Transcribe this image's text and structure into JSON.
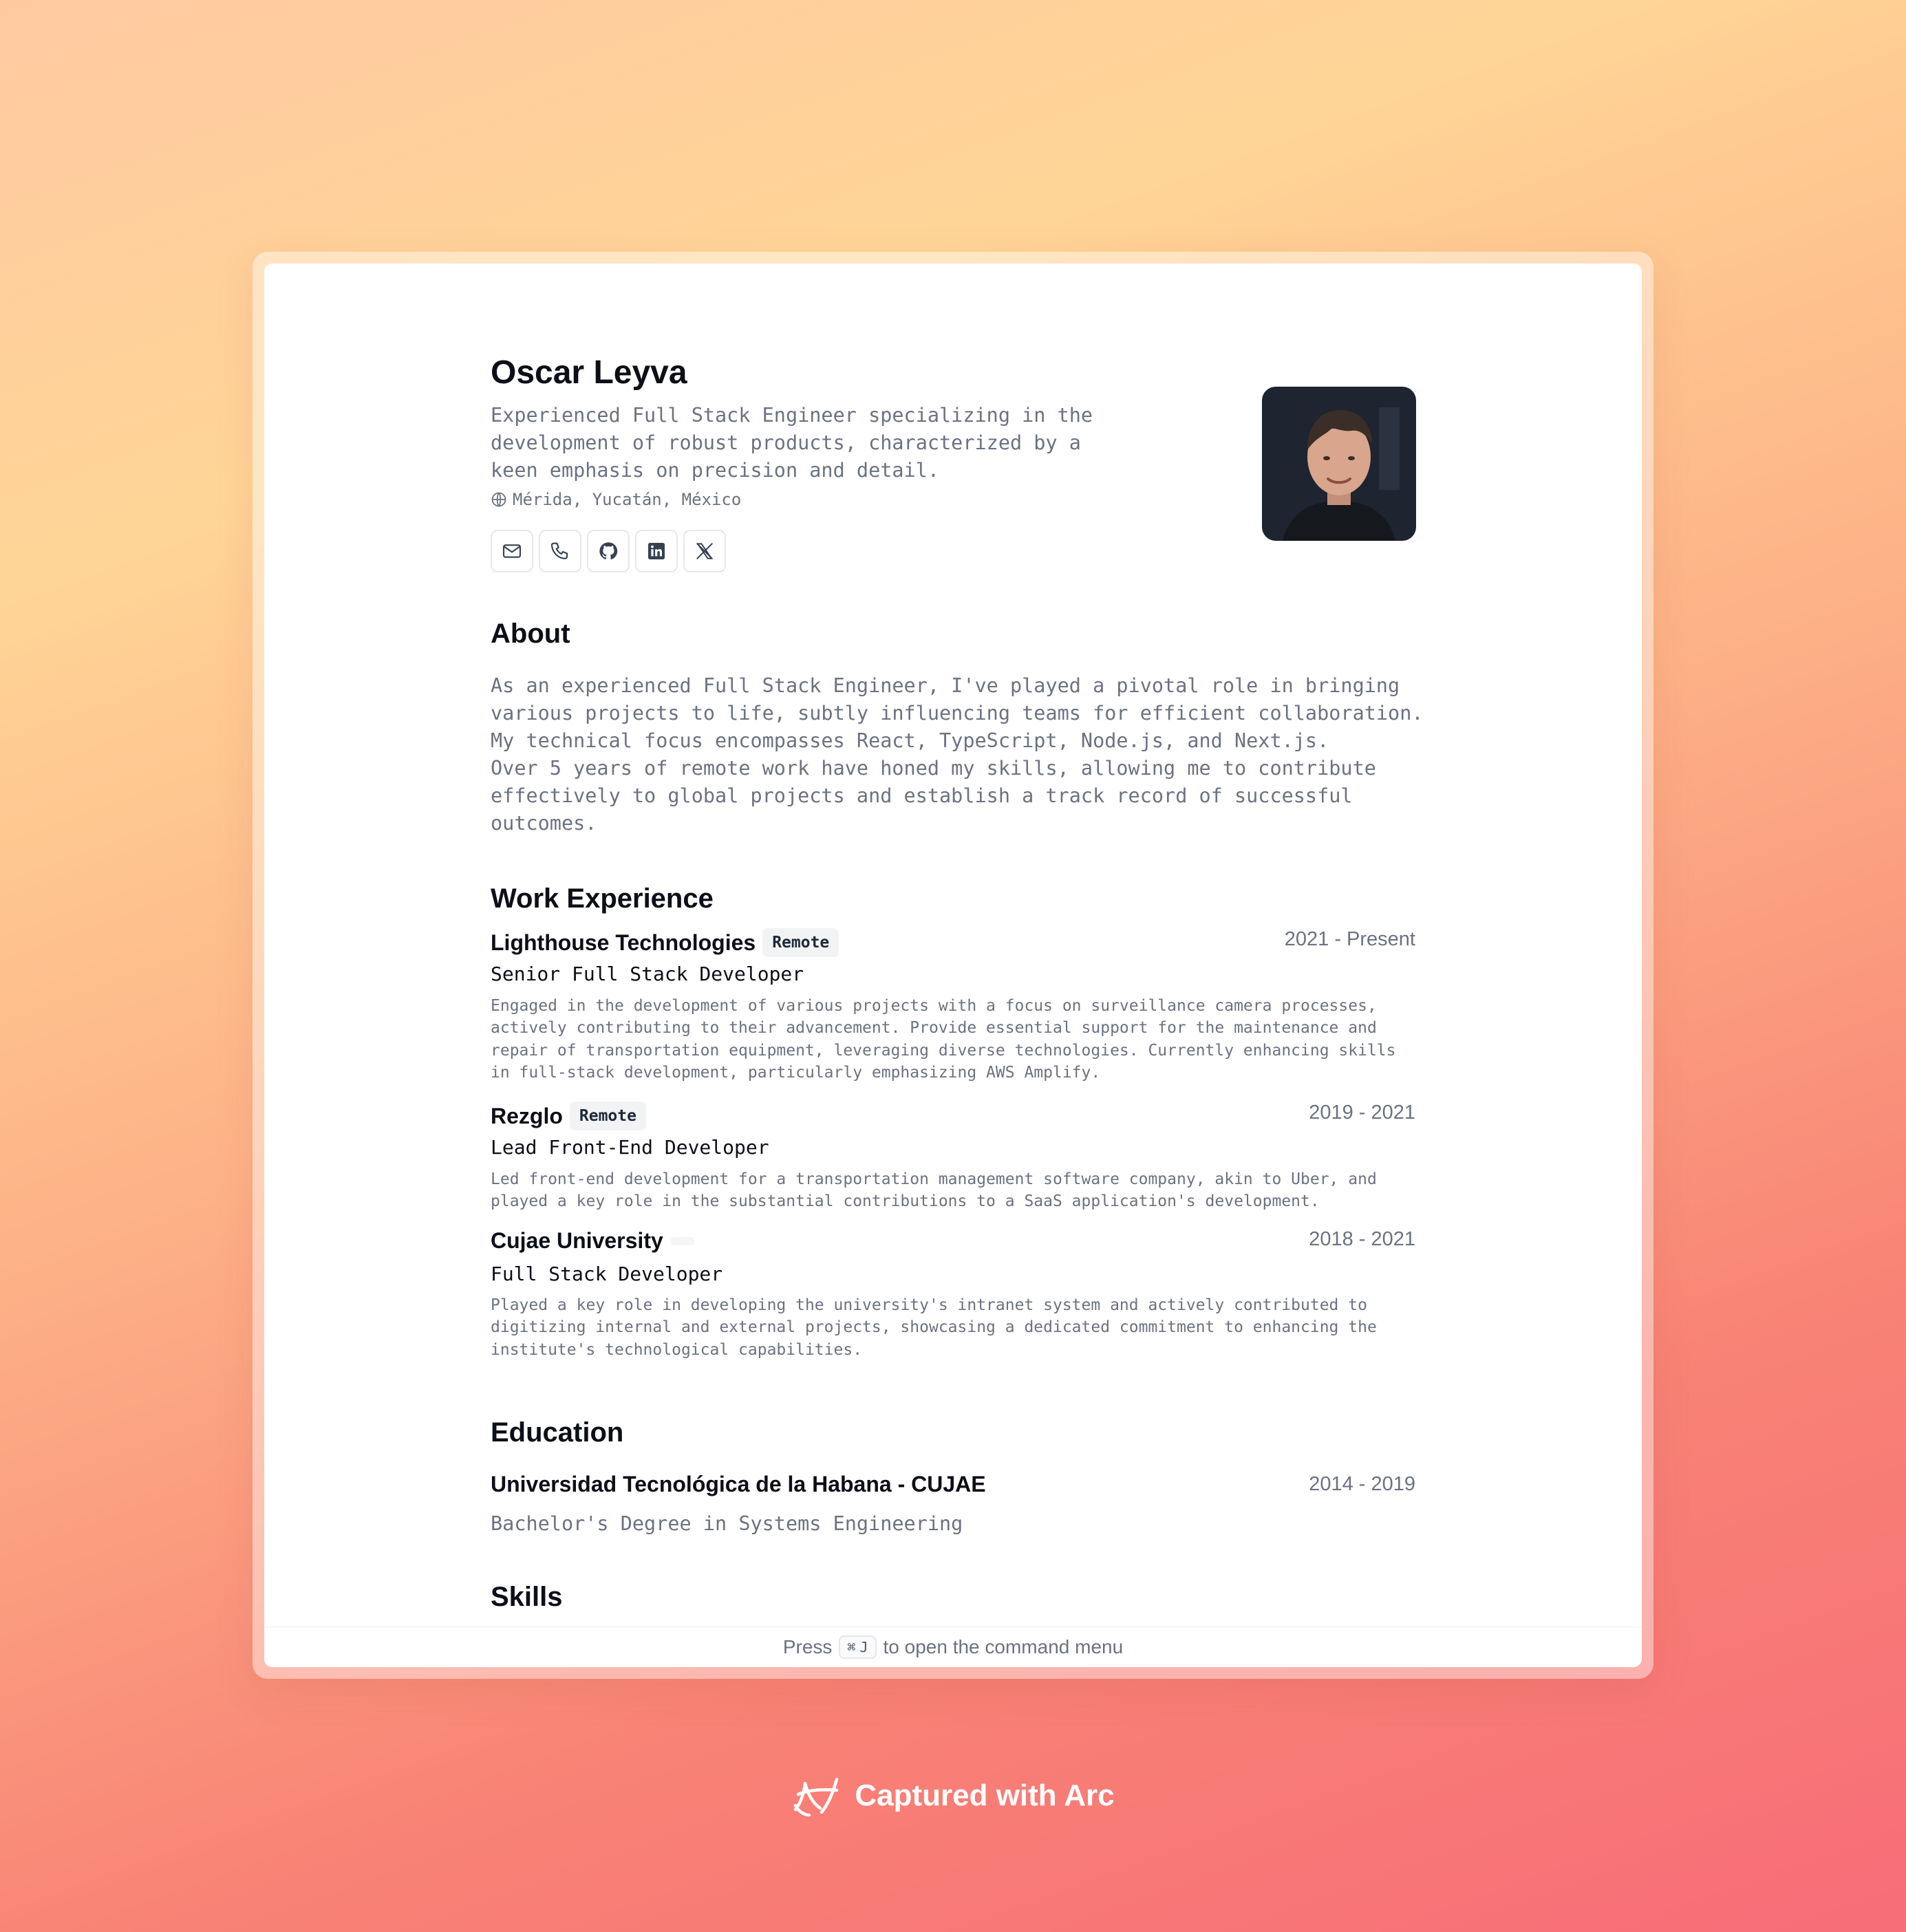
{
  "resume": {
    "name": "Oscar Leyva",
    "summary": "Experienced Full Stack Engineer specializing in the development of robust products, characterized by a keen emphasis on precision and detail.",
    "location": "Mérida, Yucatán, México",
    "contact_icons": [
      "mail-icon",
      "phone-icon",
      "github-icon",
      "linkedin-icon",
      "x-icon"
    ],
    "about": {
      "title": "About",
      "text": "As an experienced Full Stack Engineer, I've played a pivotal role in bringing various projects to life, subtly influencing teams for efficient collaboration. My technical focus encompasses React, TypeScript, Node.js, and Next.js.\nOver 5 years of remote work have honed my skills, allowing me to contribute effectively to global projects and establish a track record of successful outcomes."
    },
    "work": {
      "title": "Work Experience",
      "jobs": [
        {
          "company": "Lighthouse Technologies",
          "badge": "Remote",
          "period": "2021 - Present",
          "role": "Senior Full Stack Developer",
          "description": "Engaged in the development of various projects with a focus on surveillance camera processes, actively contributing to their advancement. Provide essential support for the maintenance and repair of transportation equipment, leveraging diverse technologies. Currently enhancing skills in full-stack development, particularly emphasizing AWS Amplify."
        },
        {
          "company": "Rezglo",
          "badge": "Remote",
          "period": "2019 - 2021",
          "role": "Lead Front-End Developer",
          "description": "Led front-end development for a transportation management software company, akin to Uber, and played a key role in the substantial contributions to a SaaS application's development."
        },
        {
          "company": "Cujae University",
          "badge": "",
          "period": "2018 - 2021",
          "role": "Full Stack Developer",
          "description": "Played a key role in developing the university's intranet system and actively contributed to digitizing internal and external projects, showcasing a dedicated commitment to enhancing the institute's technological capabilities."
        }
      ]
    },
    "education": {
      "title": "Education",
      "school": "Universidad Tecnológica de la Habana - CUJAE",
      "period": "2014 - 2019",
      "degree": "Bachelor's Degree in Systems Engineering"
    },
    "skills": {
      "title": "Skills"
    }
  },
  "footer": {
    "prefix": "Press",
    "key_symbol": "⌘",
    "key_letter": "J",
    "suffix": "to open the command menu"
  },
  "watermark": {
    "text": "Captured with Arc",
    "icon": "arc-logo-icon"
  },
  "colors": {
    "background_gradient": [
      "#ffc9a0",
      "#ffd597",
      "#fdb287",
      "#f88275",
      "#f76d78"
    ],
    "text_primary": "#0c0f17",
    "text_muted": "#6b7280",
    "badge_bg": "#f2f3f5"
  }
}
